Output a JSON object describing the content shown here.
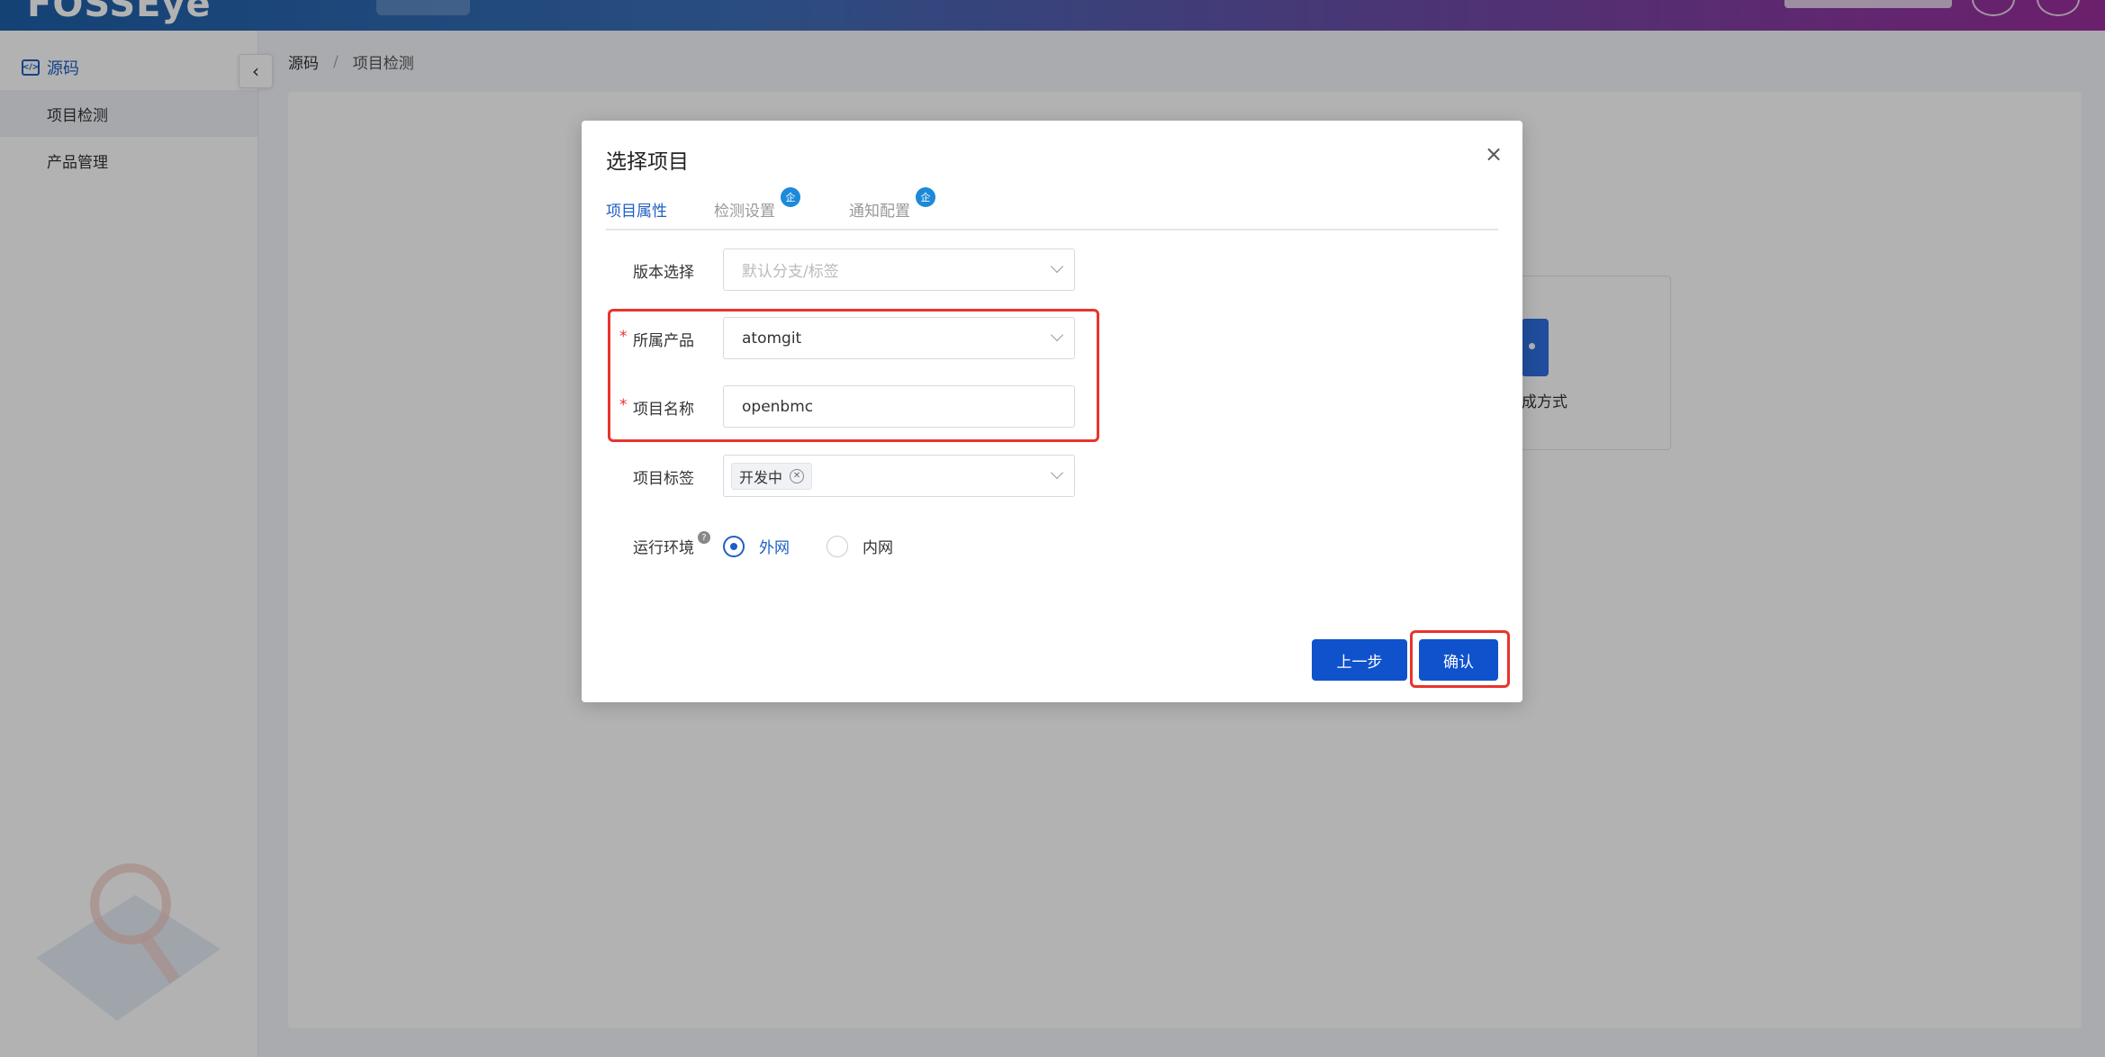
{
  "app": {
    "logo": "FOSSEye"
  },
  "sidebar": {
    "section": {
      "icon": "code-icon",
      "label": "源码"
    },
    "items": [
      {
        "label": "项目检测",
        "active": true
      },
      {
        "label": "产品管理",
        "active": false
      }
    ]
  },
  "breadcrumb": {
    "root": "源码",
    "separator": "/",
    "current": "项目检测"
  },
  "background": {
    "option_text": "成方式"
  },
  "modal": {
    "title": "选择项目",
    "close_icon": "close-icon",
    "tabs": [
      {
        "label": "项目属性",
        "active": true
      },
      {
        "label": "检测设置",
        "badge": "企"
      },
      {
        "label": "通知配置",
        "badge": "企"
      }
    ],
    "form": {
      "version": {
        "label": "版本选择",
        "placeholder": "默认分支/标签"
      },
      "product": {
        "label": "所属产品",
        "required": "*",
        "value": "atomgit"
      },
      "project_name": {
        "label": "项目名称",
        "required": "*",
        "value": "openbmc"
      },
      "project_tags": {
        "label": "项目标签",
        "tags": [
          "开发中"
        ]
      },
      "env": {
        "label": "运行环境",
        "help": "?",
        "options": [
          {
            "label": "外网",
            "checked": true
          },
          {
            "label": "内网",
            "checked": false
          }
        ]
      }
    },
    "buttons": {
      "prev": "上一步",
      "confirm": "确认"
    }
  },
  "colors": {
    "primary": "#0f52cc",
    "highlight": "#e8342c",
    "required": "#e23232"
  }
}
